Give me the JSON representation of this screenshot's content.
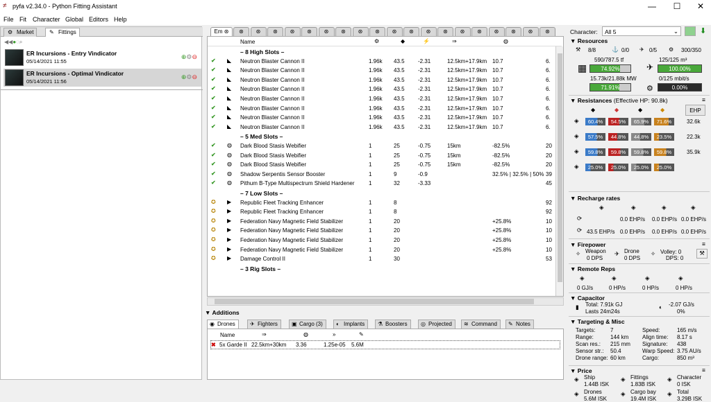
{
  "window": {
    "title": "pyfa v2.34.0 - Python Fitting Assistant",
    "minimize": "—",
    "maximize": "☐",
    "close": "✕"
  },
  "menu": [
    "File",
    "Fit",
    "Character",
    "Global",
    "Editors",
    "Help"
  ],
  "left": {
    "tabs": [
      "Market",
      "Fittings"
    ],
    "fits": [
      {
        "name": "ER Incursions - Entry Vindicator",
        "date": "05/14/2021 11:55"
      },
      {
        "name": "ER Incursions - Optimal Vindicator",
        "date": "05/14/2021 11:56"
      }
    ]
  },
  "mid": {
    "first_tab": "Em",
    "headers": [
      "Name"
    ],
    "sections": {
      "high": "– 8 High Slots –",
      "med": "– 5 Med Slots –",
      "low": "– 7 Low Slots –",
      "rig": "– 3 Rig Slots –"
    },
    "high": [
      [
        "Neutron Blaster Cannon II",
        "1.96k",
        "43.5",
        "-2.31",
        "12.5km+17.9km",
        "10.7",
        "6."
      ],
      [
        "Neutron Blaster Cannon II",
        "1.96k",
        "43.5",
        "-2.31",
        "12.5km+17.9km",
        "10.7",
        "6."
      ],
      [
        "Neutron Blaster Cannon II",
        "1.96k",
        "43.5",
        "-2.31",
        "12.5km+17.9km",
        "10.7",
        "6."
      ],
      [
        "Neutron Blaster Cannon II",
        "1.96k",
        "43.5",
        "-2.31",
        "12.5km+17.9km",
        "10.7",
        "6."
      ],
      [
        "Neutron Blaster Cannon II",
        "1.96k",
        "43.5",
        "-2.31",
        "12.5km+17.9km",
        "10.7",
        "6."
      ],
      [
        "Neutron Blaster Cannon II",
        "1.96k",
        "43.5",
        "-2.31",
        "12.5km+17.9km",
        "10.7",
        "6."
      ],
      [
        "Neutron Blaster Cannon II",
        "1.96k",
        "43.5",
        "-2.31",
        "12.5km+17.9km",
        "10.7",
        "6."
      ],
      [
        "Neutron Blaster Cannon II",
        "1.96k",
        "43.5",
        "-2.31",
        "12.5km+17.9km",
        "10.7",
        "6."
      ]
    ],
    "med": [
      [
        "Dark Blood Stasis Webifier",
        "1",
        "25",
        "-0.75",
        "15km",
        "-82.5%",
        "20"
      ],
      [
        "Dark Blood Stasis Webifier",
        "1",
        "25",
        "-0.75",
        "15km",
        "-82.5%",
        "20"
      ],
      [
        "Dark Blood Stasis Webifier",
        "1",
        "25",
        "-0.75",
        "15km",
        "-82.5%",
        "20"
      ],
      [
        "Shadow Serpentis Sensor Booster",
        "1",
        "9",
        "-0.9",
        "",
        "32.5% | 32.5% | 50%",
        "39"
      ],
      [
        "Pithum B-Type Multispectrum Shield Hardener",
        "1",
        "32",
        "-3.33",
        "",
        "",
        "45"
      ]
    ],
    "low": [
      [
        "Republic Fleet Tracking Enhancer",
        "1",
        "8",
        "",
        "",
        "",
        "92"
      ],
      [
        "Republic Fleet Tracking Enhancer",
        "1",
        "8",
        "",
        "",
        "",
        "92"
      ],
      [
        "Federation Navy Magnetic Field Stabilizer",
        "1",
        "20",
        "",
        "",
        "+25.8%",
        "10"
      ],
      [
        "Federation Navy Magnetic Field Stabilizer",
        "1",
        "20",
        "",
        "",
        "+25.8%",
        "10"
      ],
      [
        "Federation Navy Magnetic Field Stabilizer",
        "1",
        "20",
        "",
        "",
        "+25.8%",
        "10"
      ],
      [
        "Federation Navy Magnetic Field Stabilizer",
        "1",
        "20",
        "",
        "",
        "+25.8%",
        "10"
      ],
      [
        "Damage Control II",
        "1",
        "30",
        "",
        "",
        "",
        "53"
      ]
    ],
    "additions_title": "Additions",
    "add_tabs": [
      "Drones",
      "Fighters",
      "Cargo (3)",
      "Implants",
      "Boosters",
      "Projected",
      "Command",
      "Notes"
    ],
    "drone_header": "Name",
    "drone": [
      "5x Garde II",
      "22.5km+30km",
      "3.36",
      "1.25e-05",
      "5.6M"
    ]
  },
  "right": {
    "character_label": "Character:",
    "character_value": "All 5",
    "resources_title": "Resources",
    "slots": [
      "8/8",
      "0/0",
      "0/5",
      "300/350"
    ],
    "cpu": "590/787.5 tf",
    "cpu_pct": "74.92%",
    "cpu_fill": 74.92,
    "drone_bay": "125/125 m³",
    "drone_pct": "100.00%",
    "drone_fill": 100,
    "pg": "15.73k/21.88k MW",
    "pg_pct": "71.91%",
    "pg_fill": 71.91,
    "bandwidth": "0/125 mbit/s",
    "bw_pct": "0.00%",
    "bw_fill": 0,
    "res_title": "Resistances",
    "ehp_total": "(Effective HP: 90.8k)",
    "ehp_btn": "EHP",
    "res": [
      [
        "60.4%",
        "54.5%",
        "65.9%",
        "71.6%",
        "32.6k"
      ],
      [
        "57.5%",
        "44.8%",
        "44.8%",
        "23.5%",
        "22.3k"
      ],
      [
        "59.8%",
        "59.8%",
        "59.8%",
        "59.8%",
        "35.9k"
      ],
      [
        "25.0%",
        "25.0%",
        "25.0%",
        "25.0%",
        ""
      ]
    ],
    "recharge_title": "Recharge rates",
    "recharge": [
      "0.0 EHP/s",
      "0.0 EHP/s",
      "0.0 EHP/s",
      "43.5 EHP/s",
      "0.0 EHP/s",
      "0.0 EHP/s",
      "0.0 EHP/s"
    ],
    "fp_title": "Firepower",
    "weapon": "Weapon",
    "weapon_dps": "0 DPS",
    "drone_label": "Drone",
    "drone_dps": "0 DPS",
    "volley": "Volley: 0",
    "dps": "DPS: 0",
    "rr_title": "Remote Reps",
    "rr": [
      "0 GJ/s",
      "0 HP/s",
      "0 HP/s",
      "0 HP/s"
    ],
    "cap_title": "Capacitor",
    "cap_total": "Total: 7.91k GJ",
    "cap_lasts": "Lasts 24m24s",
    "cap_delta": "-2.07 GJ/s",
    "cap_pct": "0%",
    "tgt_title": "Targeting & Misc",
    "tgt_left": [
      [
        "Targets:",
        "7"
      ],
      [
        "Range:",
        "144 km"
      ],
      [
        "Scan res.:",
        "215 mm"
      ],
      [
        "Sensor str.:",
        "50.4"
      ],
      [
        "Drone range:",
        "60 km"
      ]
    ],
    "tgt_right": [
      [
        "Speed:",
        "165 m/s"
      ],
      [
        "Align time:",
        "8.17 s"
      ],
      [
        "Signature:",
        "438"
      ],
      [
        "Warp Speed:",
        "3.75 AU/s"
      ],
      [
        "Cargo:",
        "850 m³"
      ]
    ],
    "price_title": "Price",
    "price": [
      [
        "Ship",
        "1.44B ISK"
      ],
      [
        "Fittings",
        "1.83B ISK"
      ],
      [
        "Character",
        "0 ISK"
      ],
      [
        "Drones",
        "5.6M ISK"
      ],
      [
        "Cargo bay",
        "19.4M ISK"
      ],
      [
        "Total",
        "3.29B ISK"
      ]
    ]
  }
}
